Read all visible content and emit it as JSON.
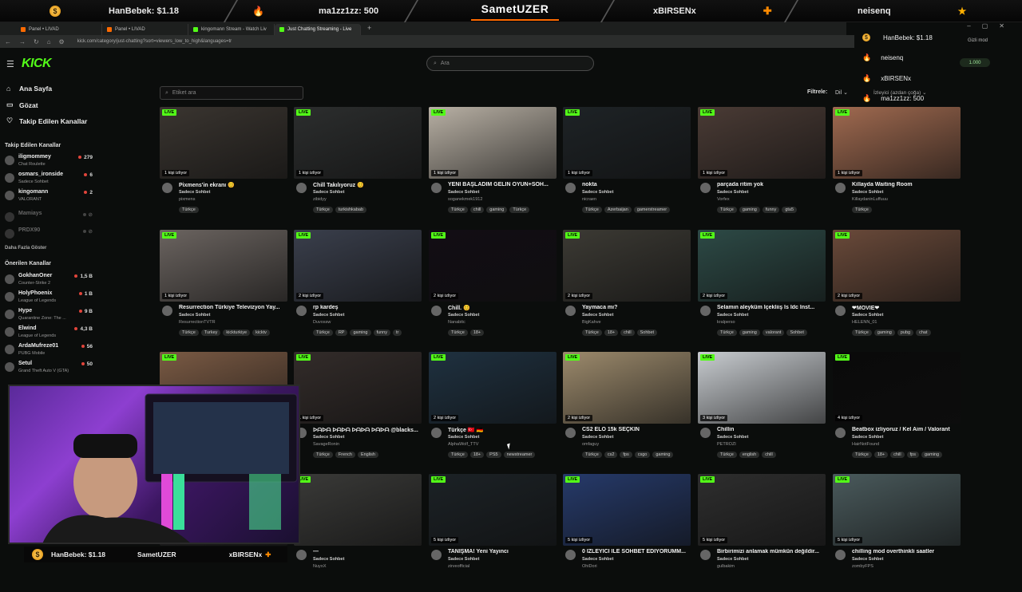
{
  "banner": {
    "left_donation": "HanBebek: $1.18",
    "mid_left_donation": "ma1zz1zz: 500",
    "streamer": "SametUZER",
    "mid_right_name": "xBIRSENx",
    "right_name": "neisenq"
  },
  "browser": {
    "tabs": [
      "Panel • LIVAD",
      "Panel • LIVAD",
      "kingomann Stream - Watch Liv",
      "Just Chatting Streaming - Live"
    ],
    "url": "kick.com/category/just-chatting?sort=viewers_low_to_high&languages=tr"
  },
  "overlay_list": {
    "rows": [
      "HanBebek: $1.18",
      "neisenq",
      "xBIRSENx",
      "ma1zz1zz: 500"
    ],
    "points": "1.000",
    "mode": "Gizli mod"
  },
  "kick": {
    "logo": "KICK",
    "search_placeholder": "Ara"
  },
  "sidebar": {
    "nav": [
      "Ana Sayfa",
      "Gözat",
      "Takip Edilen Kanallar"
    ],
    "followed_heading": "Takip Edilen Kanallar",
    "followed": [
      {
        "name": "iligmommey",
        "game": "Chat Roulette",
        "viewers": "279"
      },
      {
        "name": "osmars_ironside",
        "game": "Sadece Sohbet",
        "viewers": "6"
      },
      {
        "name": "kingomann",
        "game": "VALORANT",
        "viewers": "2"
      },
      {
        "name": "Mamiays",
        "game": "",
        "viewers": ""
      },
      {
        "name": "PRDX90",
        "game": "",
        "viewers": ""
      }
    ],
    "show_more": "Daha Fazla Göster",
    "recommended_heading": "Önerilen Kanallar",
    "recommended": [
      {
        "name": "GokhanOner",
        "game": "Counter-Strike 2",
        "viewers": "1,5 B"
      },
      {
        "name": "HolyPhoenix",
        "game": "League of Legends",
        "viewers": "1 B"
      },
      {
        "name": "Hype",
        "game": "Quarantine Zone: The ...",
        "viewers": "9 B"
      },
      {
        "name": "Elwind",
        "game": "League of Legends",
        "viewers": "4,3 B"
      },
      {
        "name": "ArdaMufreze01",
        "game": "PUBG Mobile",
        "viewers": "56"
      },
      {
        "name": "Setul",
        "game": "Grand Theft Auto V (GTA)",
        "viewers": "50"
      }
    ]
  },
  "filters": {
    "tag_placeholder": "Etiket ara",
    "label": "Filtrele:",
    "language": "Dil",
    "sort": "İzleyici (azdan çoğa)"
  },
  "cards": [
    {
      "title": "Pixmens'in ekranı 😊",
      "category": "Sadece Sohbet",
      "channel": "pixmens",
      "viewers": "1 kişi izliyor",
      "tags": [
        "Türkçe"
      ],
      "color": "#3a3530"
    },
    {
      "title": "Chill Takılıyoruz 😊",
      "category": "Sadece Sohbet",
      "channel": "zibidyy",
      "viewers": "1 kişi izliyor",
      "tags": [
        "Türkçe",
        "turkishkabab"
      ],
      "color": "#2c2e2e"
    },
    {
      "title": "YENİ BAŞLADIM GELİN OYUN+SOH...",
      "category": "Sadece Sohbet",
      "channel": "soganekmek1912",
      "viewers": "1 kişi izliyor",
      "tags": [
        "Türkçe",
        "chill",
        "gaming",
        "Türkçe"
      ],
      "color": "#b8b0a4"
    },
    {
      "title": "nokta",
      "category": "Sadece Sohbet",
      "channel": "nicraen",
      "viewers": "1 kişi izliyor",
      "tags": [
        "Türkçe",
        "Azerbaijan",
        "gamerstreamer"
      ],
      "color": "#1e2326"
    },
    {
      "title": "parçada ritim yok",
      "category": "Sadece Sohbet",
      "channel": "Vorfex",
      "viewers": "1 kişi izliyor",
      "tags": [
        "Türkçe",
        "gaming",
        "funny",
        "gta5"
      ],
      "color": "#4a3b35"
    },
    {
      "title": "Killayda Waiting Room",
      "category": "Sadece Sohbet",
      "channel": "KillaydaninLuffuuu",
      "viewers": "1 kişi izliyor",
      "tags": [
        "Türkçe"
      ],
      "color": "#a06a50"
    },
    {
      "title": "Resurrection Türkiye Televizyon Yay...",
      "category": "Sadece Sohbet",
      "channel": "ResurrectionTVTR",
      "viewers": "1 kişi izliyor",
      "tags": [
        "Türkçe",
        "Turkey",
        "kickturkiye",
        "kicktv"
      ],
      "color": "#6b6460"
    },
    {
      "title": "rp kardeş",
      "category": "Sadece Sohbet",
      "channel": "Duvossw",
      "viewers": "2 kişi izliyor",
      "tags": [
        "Türkçe",
        "RP",
        "gaming",
        "funny",
        "tr"
      ],
      "color": "#3a3f4c"
    },
    {
      "title": "Chill. 😊",
      "category": "Sadece Sohbet",
      "channel": "Nanabitc",
      "viewers": "2 kişi izliyor",
      "tags": [
        "Türkçe",
        "18+"
      ],
      "color": "#120d14"
    },
    {
      "title": "Yaymaca mı?",
      "category": "Sadece Sohbet",
      "channel": "BigKahve",
      "viewers": "2 kişi izliyor",
      "tags": [
        "Türkçe",
        "18+",
        "chill",
        "Sohbet"
      ],
      "color": "#3c3a34"
    },
    {
      "title": "Selamın aleyküm İçekliiş İs İdc İnst...",
      "category": "Sadece Sohbet",
      "channel": "kralperso",
      "viewers": "2 kişi izliyor",
      "tags": [
        "Türkçe",
        "gaming",
        "valorant",
        "Sohbet"
      ],
      "color": "#2d4a46"
    },
    {
      "title": "❤MOVIE❤",
      "category": "Sadece Sohbet",
      "channel": "HELENN_01",
      "viewers": "2 kişi izliyor",
      "tags": [
        "Türkçe",
        "gaming",
        "pubg",
        "chat"
      ],
      "color": "#6a4a3a"
    },
    {
      "title": "",
      "category": "",
      "channel": "",
      "viewers": "",
      "tags": [],
      "color": "#7a5a44"
    },
    {
      "title": "ᐅᗩᐅᗩ ᐅᗩᐅᗩ ᐅᗩᐅᗩ ᐅᗩᐅᗩ @blacks...",
      "category": "Sadece Sohbet",
      "channel": "SavageRonin",
      "viewers": "1 kişi izliyor",
      "tags": [
        "Türkçe",
        "French",
        "English"
      ],
      "color": "#332c2a"
    },
    {
      "title": "Türkçe 🇹🇷 🇩🇪",
      "category": "Sadece Sohbet",
      "channel": "AlphaWolf_TTV",
      "viewers": "2 kişi izliyor",
      "tags": [
        "Türkçe",
        "18+",
        "PS5",
        "newstreamer"
      ],
      "color": "#1f3140"
    },
    {
      "title": "CS2 ELO 15k SEÇKİN",
      "category": "Sadece Sohbet",
      "channel": "omfaguy",
      "viewers": "2 kişi izliyor",
      "tags": [
        "Türkçe",
        "cs2",
        "fps",
        "csgo",
        "gaming"
      ],
      "color": "#9c8a6c"
    },
    {
      "title": "Chillin",
      "category": "Sadece Sohbet",
      "channel": "PETROZI",
      "viewers": "3 kişi izliyor",
      "tags": [
        "Türkçe",
        "english",
        "chill"
      ],
      "color": "#c8ccd0"
    },
    {
      "title": "Beatbox izliyoruz / Kel Aim / Valorant",
      "category": "Sadece Sohbet",
      "channel": "HairNotFound",
      "viewers": "4 kişi izliyor",
      "tags": [
        "Türkçe",
        "18+",
        "chill",
        "fps",
        "gaming"
      ],
      "color": "#0a0a0a"
    },
    {
      "title": "",
      "category": "",
      "channel": "",
      "viewers": "",
      "tags": [],
      "color": "#222"
    },
    {
      "title": "—",
      "category": "Sadece Sohbet",
      "channel": "NuyoX",
      "viewers": "",
      "tags": [],
      "color": "#3a3a38"
    },
    {
      "title": "TANIŞMA! Yeni Yayıncı",
      "category": "Sadece Sohbet",
      "channel": "zirveofficial",
      "viewers": "5 kişi izliyor",
      "tags": [],
      "color": "#1c2226"
    },
    {
      "title": "0 İZLEYİCİ İLE SOHBET EDİYORUMM...",
      "category": "Sadece Sohbet",
      "channel": "OhiDori",
      "viewers": "5 kişi izliyor",
      "tags": [],
      "color": "#263a6a"
    },
    {
      "title": "Birbirimizi anlamak mümkün değildir...",
      "category": "Sadece Sohbet",
      "channel": "gulbakim",
      "viewers": "5 kişi izliyor",
      "tags": [],
      "color": "#2e2e2e"
    },
    {
      "title": "chilling mod overthinkli saatler",
      "category": "Sadece Sohbet",
      "channel": "zombyFPS",
      "viewers": "5 kişi izliyor",
      "tags": [],
      "color": "#4a5a5c"
    }
  ],
  "webcam_bar": {
    "left": "HanBebek: $1.18",
    "center": "SametUZER",
    "right": "xBIRSENx"
  },
  "colors": {
    "accent": "#53fc18",
    "donation": "#ff8a00"
  }
}
